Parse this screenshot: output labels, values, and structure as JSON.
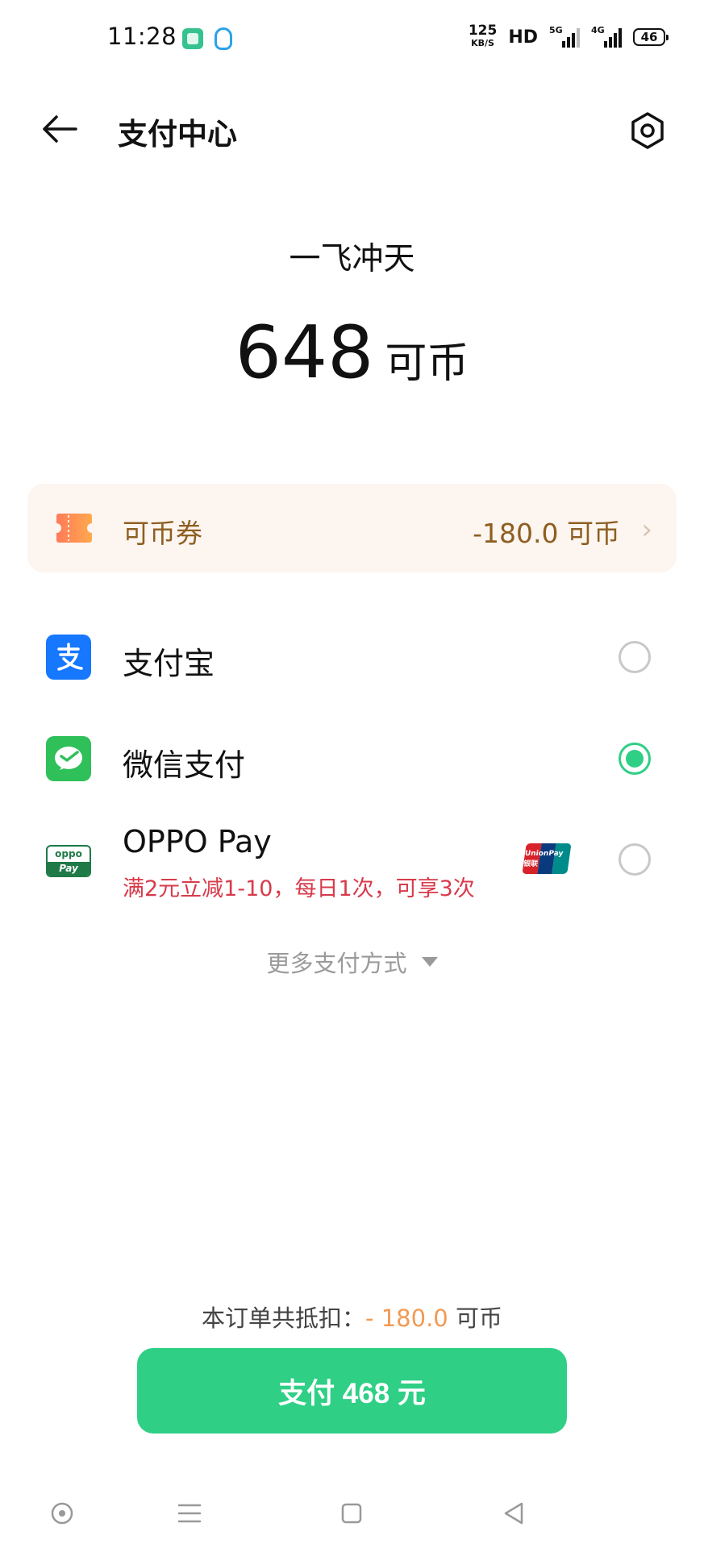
{
  "status_bar": {
    "time": "11:28",
    "net_speed": "125",
    "net_speed_unit": "KB/S",
    "hd": "HD",
    "sig1_label": "5G",
    "sig2_label": "4G",
    "battery": "46"
  },
  "header": {
    "title": "支付中心"
  },
  "product": {
    "name": "一飞冲天",
    "amount": "648",
    "unit": "可币"
  },
  "coupon": {
    "label": "可币券",
    "value": "-180.0 可币",
    "chevron": "›"
  },
  "payment_methods": [
    {
      "label": "支付宝",
      "selected": false,
      "icon": "alipay-icon"
    },
    {
      "label": "微信支付",
      "selected": true,
      "icon": "wechat-icon"
    },
    {
      "label": "OPPO Pay",
      "selected": false,
      "icon": "oppo-pay-icon",
      "promo": "满2元立减1-10，每日1次，可享3次",
      "icon_top": "oppo",
      "icon_bottom": "Pay",
      "badge": "UnionPay 银联"
    }
  ],
  "more_methods": {
    "label": "更多支付方式"
  },
  "summary": {
    "prefix": "本订单共抵扣：",
    "deduct": "- 180.0",
    "suffix": " 可币"
  },
  "pay_button": {
    "label": "支付 468 元"
  },
  "colors": {
    "accent": "#2fcf86",
    "coupon_text": "#8d5f20",
    "coupon_bg": "#fdf5f0",
    "promo": "#d73b4b",
    "deduct": "#f29a53"
  }
}
